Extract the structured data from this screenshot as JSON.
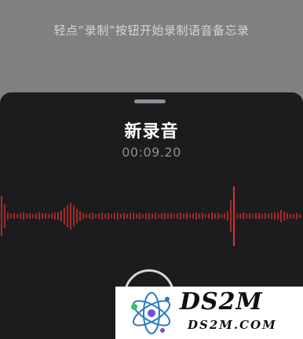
{
  "background_hint": "轻点“录制”按钮开始录制语音备忘录",
  "recording_sheet": {
    "title": "新录音",
    "elapsed_time": "00:09.20"
  },
  "colors": {
    "waveform": "#e0312b",
    "playhead": "#e0312b",
    "sheet_background": "#1c1c1e"
  },
  "watermark": {
    "main_text": "DS2M",
    "sub_text": "DS2M.COM"
  }
}
